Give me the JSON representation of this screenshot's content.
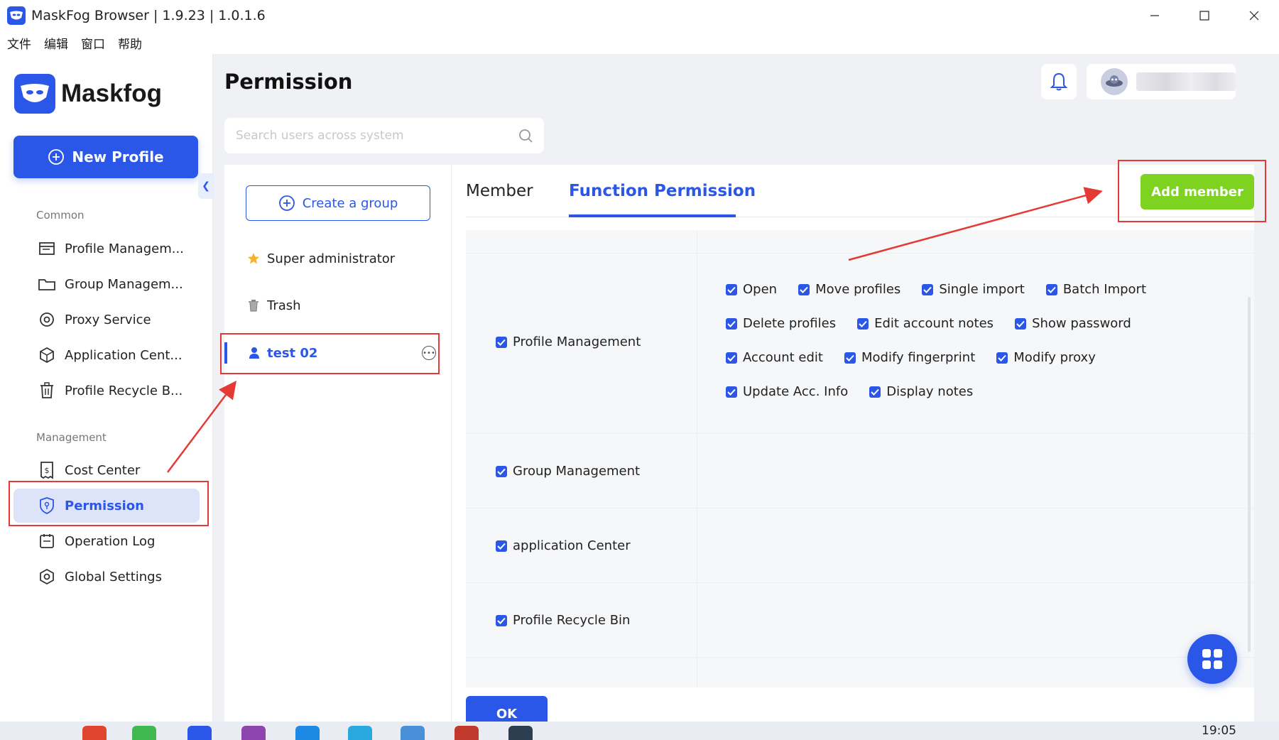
{
  "window": {
    "title": "MaskFog Browser | 1.9.23 | 1.0.1.6"
  },
  "menu": [
    "文件",
    "编辑",
    "窗口",
    "帮助"
  ],
  "sidebar": {
    "logo_text": "Maskfog",
    "new_profile": "New Profile",
    "sections": {
      "common": "Common",
      "management": "Management"
    },
    "common_items": [
      {
        "label": "Profile Managem...",
        "icon": "profile-icon"
      },
      {
        "label": "Group Managem...",
        "icon": "folder-icon"
      },
      {
        "label": "Proxy Service",
        "icon": "location-pin-icon"
      },
      {
        "label": "Application Cent...",
        "icon": "cube-icon"
      },
      {
        "label": "Profile Recycle B...",
        "icon": "trash-icon"
      }
    ],
    "management_items": [
      {
        "label": "Cost Center",
        "icon": "receipt-dollar-icon"
      },
      {
        "label": "Permission",
        "icon": "shield-key-icon",
        "active": true
      },
      {
        "label": "Operation Log",
        "icon": "log-icon"
      },
      {
        "label": "Global Settings",
        "icon": "hexagon-settings-icon"
      }
    ]
  },
  "header": {
    "page_title": "Permission",
    "search_placeholder": "Search users across system"
  },
  "groups": {
    "create_label": "Create a group",
    "items": [
      {
        "label": "Super administrator",
        "icon": "star-icon"
      },
      {
        "label": "Trash",
        "icon": "trash-icon"
      }
    ],
    "active": {
      "label": "test 02",
      "icon": "user-icon"
    }
  },
  "tabs": {
    "member": "Member",
    "function_permission": "Function Permission",
    "active": "function_permission"
  },
  "add_member": "Add member",
  "permissions": [
    {
      "label": "Profile Management",
      "checked": true,
      "sub": [
        [
          {
            "label": "Open",
            "checked": true
          },
          {
            "label": "Move profiles",
            "checked": true
          },
          {
            "label": "Single import",
            "checked": true
          },
          {
            "label": "Batch Import",
            "checked": true
          }
        ],
        [
          {
            "label": "Delete profiles",
            "checked": true
          },
          {
            "label": "Edit account notes",
            "checked": true
          },
          {
            "label": "Show password",
            "checked": true
          }
        ],
        [
          {
            "label": "Account edit",
            "checked": true
          },
          {
            "label": "Modify fingerprint",
            "checked": true
          },
          {
            "label": "Modify proxy",
            "checked": true
          }
        ],
        [
          {
            "label": "Update Acc. Info",
            "checked": true
          },
          {
            "label": "Display notes",
            "checked": true
          }
        ]
      ]
    },
    {
      "label": "Group Management",
      "checked": true
    },
    {
      "label": "application Center",
      "checked": true
    },
    {
      "label": "Profile Recycle Bin",
      "checked": true
    }
  ],
  "ok_button": "OK",
  "taskbar": {
    "clock": "19:05"
  },
  "colors": {
    "accent": "#2b57e8",
    "add_member_green": "#7ed321",
    "highlight_red": "#e53935"
  }
}
